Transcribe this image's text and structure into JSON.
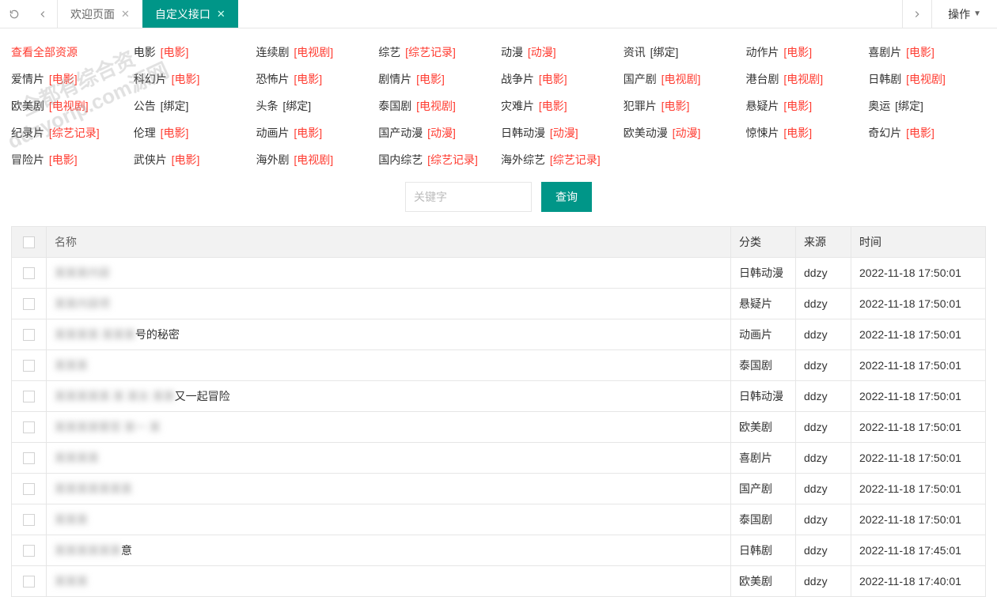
{
  "topbar": {
    "tabs": [
      {
        "label": "欢迎页面",
        "active": false
      },
      {
        "label": "自定义接口",
        "active": true
      }
    ],
    "ops_label": "操作"
  },
  "watermark": {
    "line1": "全都有综合资",
    "line2": "ddzyorip.com源网"
  },
  "categories": [
    {
      "label": "查看全部资源",
      "tag": "",
      "red": true
    },
    {
      "label": "电影",
      "tag": "[电影]"
    },
    {
      "label": "连续剧",
      "tag": "[电视剧]"
    },
    {
      "label": "综艺",
      "tag": "[综艺记录]"
    },
    {
      "label": "动漫",
      "tag": "[动漫]"
    },
    {
      "label": "资讯",
      "tag": "[绑定]",
      "bind": true
    },
    {
      "label": "动作片",
      "tag": "[电影]"
    },
    {
      "label": "喜剧片",
      "tag": "[电影]"
    },
    {
      "label": "爱情片",
      "tag": "[电影]"
    },
    {
      "label": "科幻片",
      "tag": "[电影]"
    },
    {
      "label": "恐怖片",
      "tag": "[电影]"
    },
    {
      "label": "剧情片",
      "tag": "[电影]"
    },
    {
      "label": "战争片",
      "tag": "[电影]"
    },
    {
      "label": "国产剧",
      "tag": "[电视剧]"
    },
    {
      "label": "港台剧",
      "tag": "[电视剧]"
    },
    {
      "label": "日韩剧",
      "tag": "[电视剧]"
    },
    {
      "label": "欧美剧",
      "tag": "[电视剧]"
    },
    {
      "label": "公告",
      "tag": "[绑定]",
      "bind": true
    },
    {
      "label": "头条",
      "tag": "[绑定]",
      "bind": true
    },
    {
      "label": "泰国剧",
      "tag": "[电视剧]"
    },
    {
      "label": "灾难片",
      "tag": "[电影]"
    },
    {
      "label": "犯罪片",
      "tag": "[电影]"
    },
    {
      "label": "悬疑片",
      "tag": "[电影]"
    },
    {
      "label": "奥运",
      "tag": "[绑定]",
      "bind": true
    },
    {
      "label": "纪录片",
      "tag": "[综艺记录]"
    },
    {
      "label": "伦理",
      "tag": "[电影]"
    },
    {
      "label": "动画片",
      "tag": "[电影]"
    },
    {
      "label": "国产动漫",
      "tag": "[动漫]"
    },
    {
      "label": "日韩动漫",
      "tag": "[动漫]"
    },
    {
      "label": "欧美动漫",
      "tag": "[动漫]"
    },
    {
      "label": "惊悚片",
      "tag": "[电影]"
    },
    {
      "label": "奇幻片",
      "tag": "[电影]"
    },
    {
      "label": "冒险片",
      "tag": "[电影]"
    },
    {
      "label": "武侠片",
      "tag": "[电影]"
    },
    {
      "label": "海外剧",
      "tag": "[电视剧]"
    },
    {
      "label": "国内综艺",
      "tag": "[综艺记录]"
    },
    {
      "label": "海外综艺",
      "tag": "[综艺记录]"
    }
  ],
  "search": {
    "placeholder": "关键字",
    "button": "查询"
  },
  "table": {
    "headers": {
      "name": "名称",
      "cat": "分类",
      "src": "来源",
      "time": "时间"
    },
    "rows": [
      {
        "name_blur": "某某某内容",
        "name_clear": "",
        "cat": "日韩动漫",
        "src": "ddzy",
        "time": "2022-11-18 17:50:01"
      },
      {
        "name_blur": "某某内容项",
        "name_clear": "",
        "cat": "悬疑片",
        "src": "ddzy",
        "time": "2022-11-18 17:50:01"
      },
      {
        "name_blur": "某某某某 某某某",
        "name_clear": "号的秘密",
        "cat": "动画片",
        "src": "ddzy",
        "time": "2022-11-18 17:50:01"
      },
      {
        "name_blur": "某某某",
        "name_clear": "",
        "cat": "泰国剧",
        "src": "ddzy",
        "time": "2022-11-18 17:50:01"
      },
      {
        "name_blur": "某某某某某 某 某女 某某",
        "name_clear": "又一起冒险",
        "cat": "日韩动漫",
        "src": "ddzy",
        "time": "2022-11-18 17:50:01"
      },
      {
        "name_blur": "某某某某客官 某一 某",
        "name_clear": "",
        "cat": "欧美剧",
        "src": "ddzy",
        "time": "2022-11-18 17:50:01"
      },
      {
        "name_blur": "某某某某",
        "name_clear": "",
        "cat": "喜剧片",
        "src": "ddzy",
        "time": "2022-11-18 17:50:01"
      },
      {
        "name_blur": "某某某某某某某",
        "name_clear": "",
        "cat": "国产剧",
        "src": "ddzy",
        "time": "2022-11-18 17:50:01"
      },
      {
        "name_blur": "某某某",
        "name_clear": "",
        "cat": "泰国剧",
        "src": "ddzy",
        "time": "2022-11-18 17:50:01"
      },
      {
        "name_blur": "某某某某某某",
        "name_clear": "意",
        "cat": "日韩剧",
        "src": "ddzy",
        "time": "2022-11-18 17:45:01"
      },
      {
        "name_blur": "某某某",
        "name_clear": "",
        "cat": "欧美剧",
        "src": "ddzy",
        "time": "2022-11-18 17:40:01"
      }
    ]
  }
}
